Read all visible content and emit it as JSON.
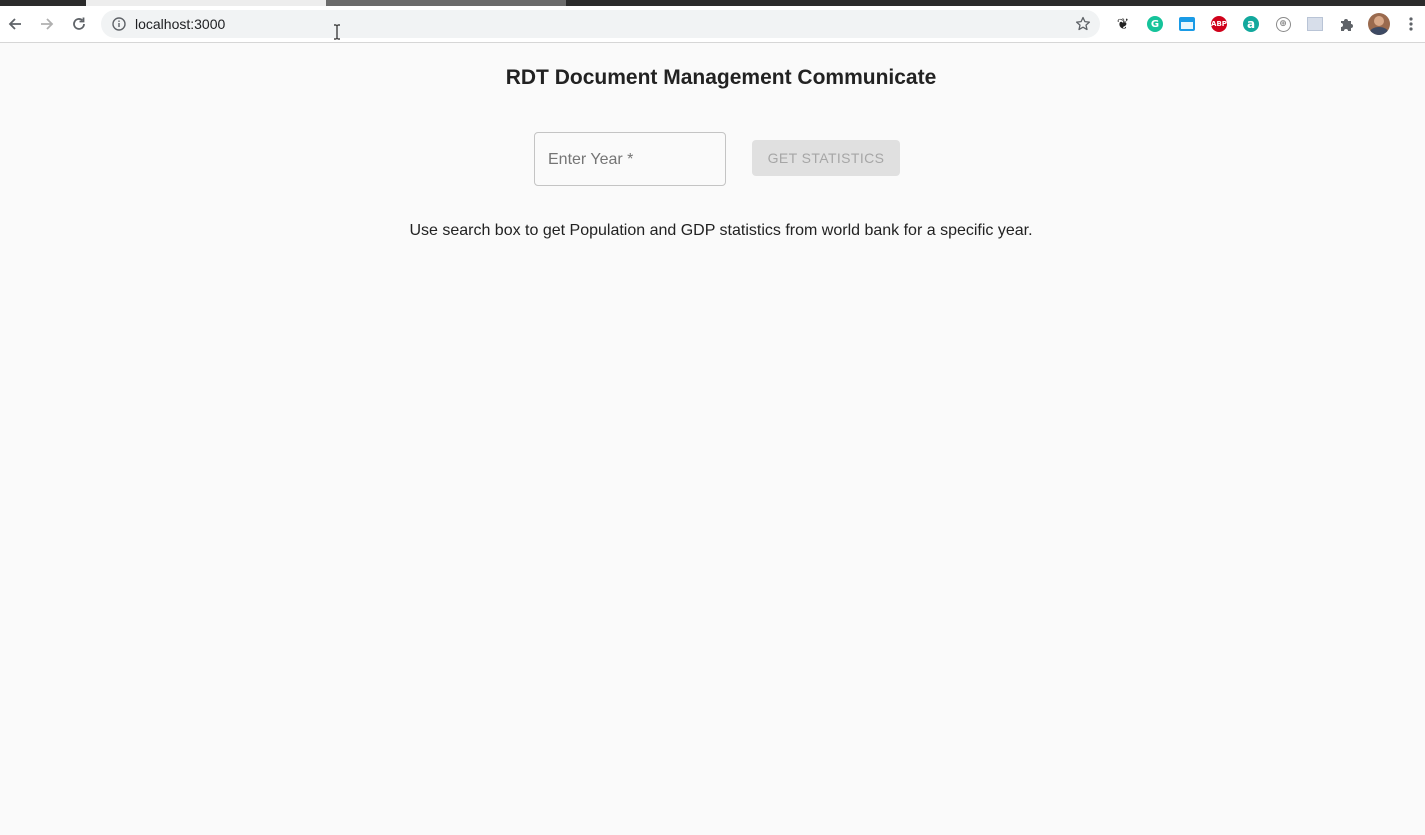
{
  "browser": {
    "url": "localhost:3000",
    "icons": {
      "back": "arrow-left-icon",
      "forward": "arrow-right-icon",
      "reload": "reload-icon",
      "info": "info-icon",
      "bookmark": "star-icon",
      "extensions": "puzzle-icon",
      "menu": "kebab-menu-icon"
    },
    "extensions": [
      {
        "name": "paw-extension",
        "glyph": "❦",
        "color": "#222222"
      },
      {
        "name": "grammarly-extension",
        "glyph": "G",
        "color": "#15c39a"
      },
      {
        "name": "window-extension",
        "glyph": "",
        "color": "#1a9be6"
      },
      {
        "name": "adblock-extension",
        "glyph": "ABP",
        "color": "#d0021b"
      },
      {
        "name": "a-extension",
        "glyph": "a",
        "color": "#12a89d"
      },
      {
        "name": "web-extension",
        "glyph": "⊕",
        "color": "#8a8a8a"
      },
      {
        "name": "screen-extension",
        "glyph": "",
        "color": "#b9c4d6"
      }
    ]
  },
  "page": {
    "title": "RDT Document Management Communicate",
    "year_input": {
      "label": "Enter Year *",
      "value": ""
    },
    "stats_button": "GET STATISTICS",
    "helper_text": "Use search box to get Population and GDP statistics from world bank for a specific year."
  },
  "colors": {
    "background": "#fafafa",
    "button_disabled_bg": "#e0e0e0",
    "button_disabled_text": "#a6a6a6"
  }
}
